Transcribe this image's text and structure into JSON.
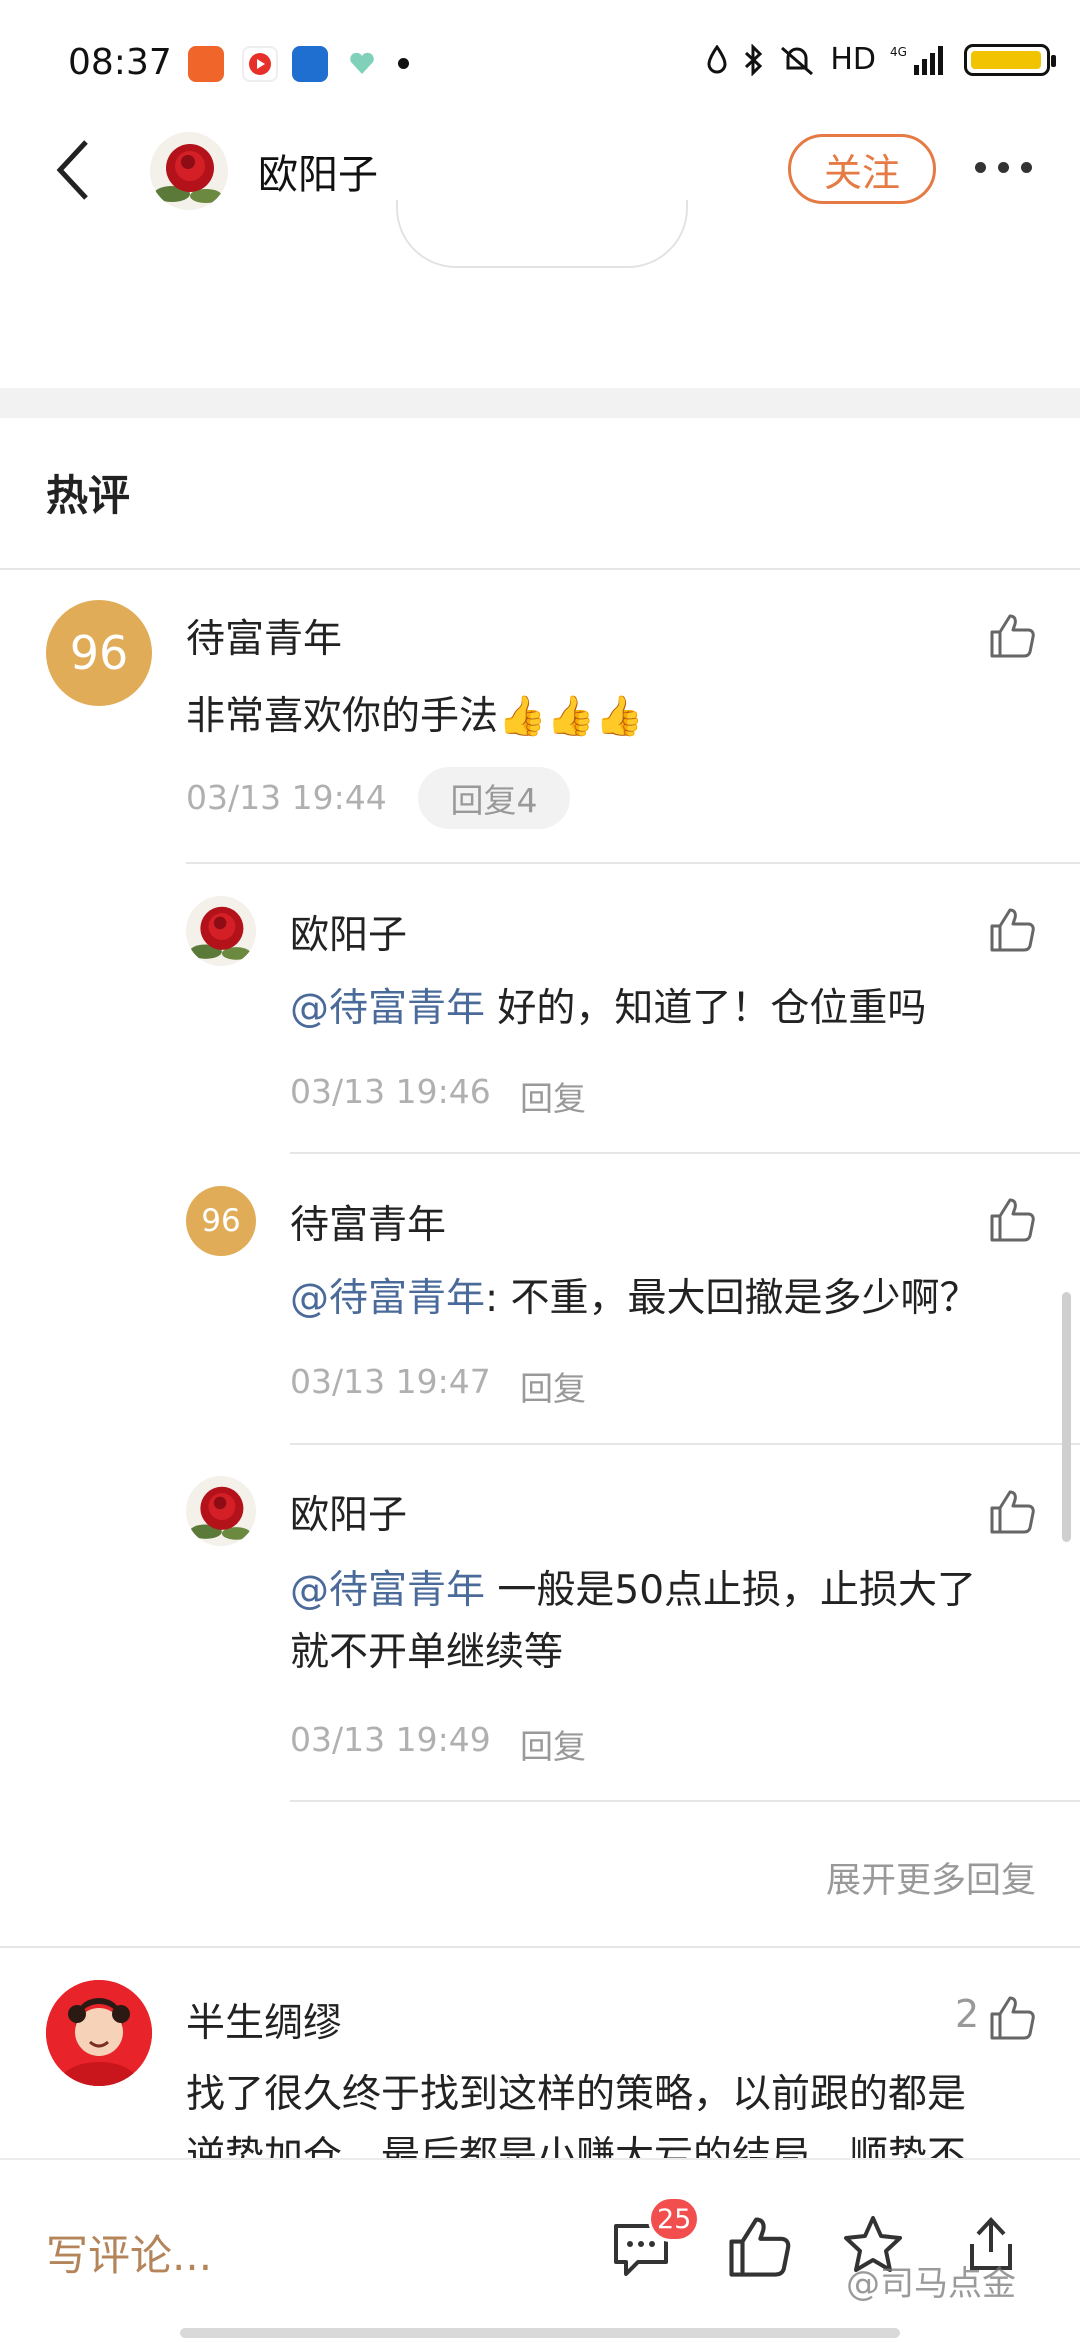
{
  "status_bar": {
    "time": "08:37",
    "network": "HD",
    "signal": "4G"
  },
  "header": {
    "username": "欧阳子",
    "follow_label": "关注"
  },
  "section": {
    "title": "热评"
  },
  "comments": [
    {
      "avatar_text": "96",
      "username": "待富青年",
      "text": "非常喜欢你的手法",
      "emoji": "👍👍👍",
      "time": "03/13 19:44",
      "reply_label": "回复4",
      "replies": [
        {
          "username": "欧阳子",
          "mention": "@待富青年",
          "text": " 好的，知道了！仓位重吗",
          "time": "03/13 19:46",
          "reply_label": "回复"
        },
        {
          "avatar_text": "96",
          "username": "待富青年",
          "mention": "@待富青年",
          "text": ": 不重，最大回撤是多少啊？",
          "time": "03/13 19:47",
          "reply_label": "回复"
        },
        {
          "username": "欧阳子",
          "mention": "@待富青年",
          "text_line1": " 一般是50点止损，止损大了",
          "text_line2": "就不开单继续等",
          "time": "03/13 19:49",
          "reply_label": "回复"
        }
      ],
      "expand_label": "展开更多回复"
    },
    {
      "username": "半生绸缪",
      "like_count": "2",
      "text_line1": "找了很久终于找到这样的策略，以前跟的都是",
      "text_line2": "逆势加仓，最后都是小赚大亏的结局，顺势不"
    }
  ],
  "bottom_bar": {
    "write_placeholder": "写评论...",
    "comment_count": "25"
  },
  "watermark": "@司马点金",
  "colors": {
    "accent": "#e57a44",
    "mention": "#4a6a9a",
    "avatar_gold": "#e1ac58",
    "badge": "#f24e4e",
    "write": "#b4845a"
  }
}
